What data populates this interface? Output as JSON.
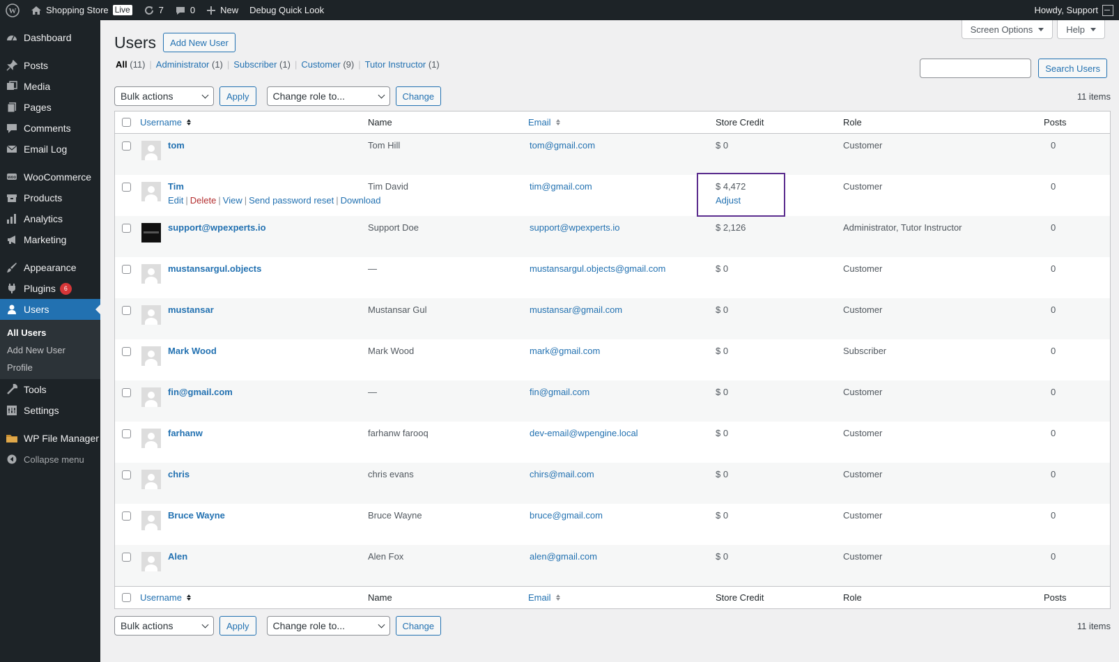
{
  "adminbar": {
    "site_name": "Shopping Store",
    "live_badge": "Live",
    "updates_count": "7",
    "comments_count": "0",
    "new_label": "New",
    "debug_label": "Debug Quick Look",
    "howdy": "Howdy, Support"
  },
  "sidebar": {
    "items": [
      {
        "label": "Dashboard",
        "icon": "dashboard-icon"
      },
      {
        "label": "Posts",
        "icon": "pin-icon"
      },
      {
        "label": "Media",
        "icon": "media-icon"
      },
      {
        "label": "Pages",
        "icon": "pages-icon"
      },
      {
        "label": "Comments",
        "icon": "comment-icon"
      },
      {
        "label": "Email Log",
        "icon": "email-icon"
      },
      {
        "label": "WooCommerce",
        "icon": "woocommerce-icon"
      },
      {
        "label": "Products",
        "icon": "products-icon"
      },
      {
        "label": "Analytics",
        "icon": "analytics-icon"
      },
      {
        "label": "Marketing",
        "icon": "megaphone-icon"
      },
      {
        "label": "Appearance",
        "icon": "brush-icon"
      },
      {
        "label": "Plugins",
        "icon": "plugin-icon",
        "badge": "6"
      },
      {
        "label": "Users",
        "icon": "user-icon"
      },
      {
        "label": "Tools",
        "icon": "wrench-icon"
      },
      {
        "label": "Settings",
        "icon": "settings-icon"
      },
      {
        "label": "WP File Manager",
        "icon": "folder-icon"
      }
    ],
    "submenu": [
      "All Users",
      "Add New User",
      "Profile"
    ],
    "collapse": "Collapse menu"
  },
  "header": {
    "screen_options": "Screen Options",
    "help": "Help",
    "title": "Users",
    "add_new": "Add New User"
  },
  "filters": [
    {
      "label": "All",
      "count": "(11)"
    },
    {
      "label": "Administrator",
      "count": "(1)"
    },
    {
      "label": "Subscriber",
      "count": "(1)"
    },
    {
      "label": "Customer",
      "count": "(9)"
    },
    {
      "label": "Tutor Instructor",
      "count": "(1)"
    }
  ],
  "search": {
    "button": "Search Users",
    "placeholder": ""
  },
  "tablenav": {
    "bulk_actions": "Bulk actions",
    "apply": "Apply",
    "change_role": "Change role to...",
    "change": "Change",
    "items": "11 items"
  },
  "columns": {
    "username": "Username",
    "name": "Name",
    "email": "Email",
    "store_credit": "Store Credit",
    "role": "Role",
    "posts": "Posts"
  },
  "users": [
    {
      "username": "tom",
      "name": "Tom Hill",
      "email": "tom@gmail.com",
      "credit": "$ 0",
      "role": "Customer",
      "posts": "0"
    },
    {
      "username": "Tim",
      "name": "Tim David",
      "email": "tim@gmail.com",
      "credit": "$ 4,472",
      "role": "Customer",
      "posts": "0"
    },
    {
      "username": "support@wpexperts.io",
      "name": "Support Doe",
      "email": "support@wpexperts.io",
      "credit": "$ 2,126",
      "role": "Administrator, Tutor Instructor",
      "posts": "0"
    },
    {
      "username": "mustansargul.objects",
      "name": "—",
      "email": "mustansargul.objects@gmail.com",
      "credit": "$ 0",
      "role": "Customer",
      "posts": "0"
    },
    {
      "username": "mustansar",
      "name": "Mustansar Gul",
      "email": "mustansar@gmail.com",
      "credit": "$ 0",
      "role": "Customer",
      "posts": "0"
    },
    {
      "username": "Mark Wood",
      "name": "Mark Wood",
      "email": "mark@gmail.com",
      "credit": "$ 0",
      "role": "Subscriber",
      "posts": "0"
    },
    {
      "username": "fin@gmail.com",
      "name": "—",
      "email": "fin@gmail.com",
      "credit": "$ 0",
      "role": "Customer",
      "posts": "0"
    },
    {
      "username": "farhanw",
      "name": "farhanw farooq",
      "email": "dev-email@wpengine.local",
      "credit": "$ 0",
      "role": "Customer",
      "posts": "0"
    },
    {
      "username": "chris",
      "name": "chris evans",
      "email": "chirs@mail.com",
      "credit": "$ 0",
      "role": "Customer",
      "posts": "0"
    },
    {
      "username": "Bruce Wayne",
      "name": "Bruce Wayne",
      "email": "bruce@gmail.com",
      "credit": "$ 0",
      "role": "Customer",
      "posts": "0"
    },
    {
      "username": "Alen",
      "name": "Alen Fox",
      "email": "alen@gmail.com",
      "credit": "$ 0",
      "role": "Customer",
      "posts": "0"
    }
  ],
  "row_actions": {
    "edit": "Edit",
    "delete": "Delete",
    "view": "View",
    "reset": "Send password reset",
    "download": "Download",
    "adjust": "Adjust"
  },
  "colors": {
    "accent": "#2271b1",
    "adminbar": "#1d2327",
    "highlight_box": "#5b2d8e",
    "delete": "#b32d2e",
    "badge": "#d63638"
  }
}
